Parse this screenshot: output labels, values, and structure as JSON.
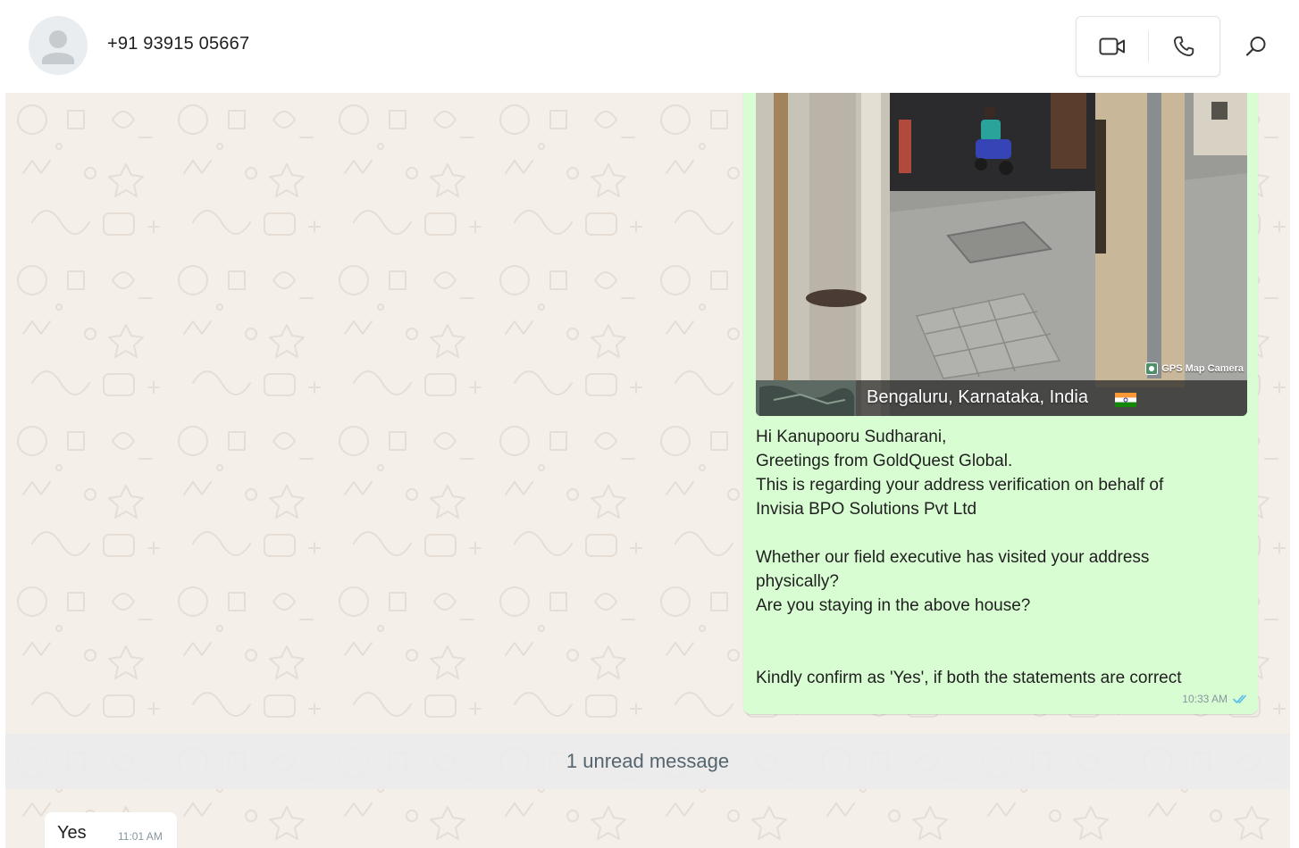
{
  "header": {
    "contact_name": "+91 93915 05667",
    "icons": {
      "avatar": "default-avatar-icon",
      "video": "video-camera-icon",
      "voice": "phone-icon",
      "search": "search-icon"
    }
  },
  "outgoing_message": {
    "photo": {
      "location_caption": "Bengaluru, Karnataka, India",
      "watermark": "GPS Map Camera",
      "flag_icon": "india-flag-icon"
    },
    "text": "Hi Kanupooru Sudharani,\nGreetings from GoldQuest Global.\nThis is regarding your address verification on behalf of\nInvisia BPO Solutions Pvt Ltd\n\nWhether our field executive has visited your address\nphysically?\nAre you staying in the above house?\n\n\nKindly confirm as 'Yes', if both the statements are correct",
    "time": "10:33 AM",
    "status_icon": "double-check-read-icon"
  },
  "unread_banner": "1 unread message",
  "incoming_message": {
    "text": "Yes",
    "time": "11:01 AM"
  },
  "colors": {
    "chat_background": "#f4efe9",
    "outgoing_bubble": "#d9fdd3",
    "incoming_bubble": "#ffffff",
    "read_tick": "#53bdeb"
  }
}
